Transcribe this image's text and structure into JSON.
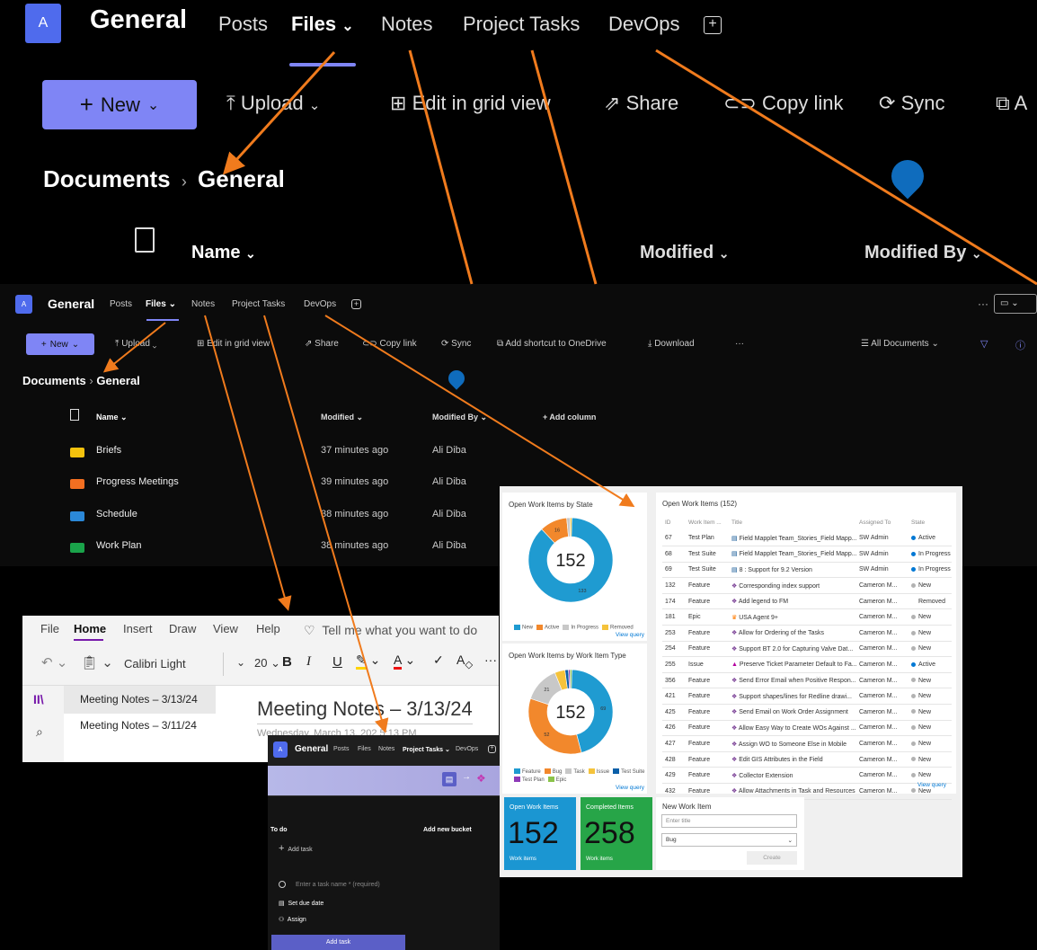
{
  "avatar_letter": "A",
  "team_name": "General",
  "tabs": [
    "Posts",
    "Files",
    "Notes",
    "Project Tasks",
    "DevOps"
  ],
  "toolbar": {
    "new": "New",
    "upload": "Upload",
    "edit_grid": "Edit in grid view",
    "share": "Share",
    "copy_link": "Copy link",
    "sync": "Sync",
    "add_shortcut": "Add shortcut to OneDrive",
    "download": "Download",
    "more": "···",
    "all_documents": "All Documents"
  },
  "breadcrumb": {
    "root": "Documents",
    "current": "General"
  },
  "columns": {
    "name": "Name",
    "modified": "Modified",
    "modified_by": "Modified By",
    "add_column": "+ Add column"
  },
  "files": [
    {
      "name": "Briefs",
      "modified": "37 minutes ago",
      "by": "Ali Diba",
      "color": "#f4c20d"
    },
    {
      "name": "Progress Meetings",
      "modified": "39 minutes ago",
      "by": "Ali Diba",
      "color": "#f36f21"
    },
    {
      "name": "Schedule",
      "modified": "38 minutes ago",
      "by": "Ali Diba",
      "color": "#2b88d8"
    },
    {
      "name": "Work Plan",
      "modified": "38 minutes ago",
      "by": "Ali Diba",
      "color": "#1aa34a"
    }
  ],
  "onenote": {
    "menu": [
      "File",
      "Home",
      "Insert",
      "Draw",
      "View",
      "Help"
    ],
    "tell_me": "Tell me what you want to do",
    "font": "Calibri Light",
    "size": "20",
    "pages": [
      "Meeting Notes – 3/13/24",
      "Meeting Notes – 3/11/24"
    ],
    "page_title": "Meeting Notes – 3/13/24",
    "date_line": "Wednesday, March 13, 202   5:13 PM"
  },
  "planner": {
    "tab_files": "Files",
    "tab_notes": "Notes",
    "todo": "To do",
    "add_bucket": "Add new bucket",
    "add_task": "Add task",
    "task_placeholder": "Enter a task name * (required)",
    "set_due": "Set due date",
    "assign": "Assign",
    "add_task_button": "Add task"
  },
  "devops": {
    "state_title": "Open Work Items by State",
    "state_legend": [
      "New",
      "Active",
      "In Progress",
      "Removed"
    ],
    "view_query": "View query",
    "type_title": "Open Work Items by Work Item Type",
    "type_legend": [
      "Feature",
      "Bug",
      "Task",
      "Issue",
      "Test Suite",
      "Test Plan",
      "Epic"
    ],
    "center_value": "152",
    "table_title": "Open Work Items (152)",
    "table_headers": [
      "ID",
      "Work Item ...",
      "Title",
      "Assigned To",
      "State"
    ],
    "rows": [
      [
        "67",
        "Test Plan",
        "Field Mapplet Team_Stories_Field Mapp...",
        "SW Admin",
        "Active"
      ],
      [
        "68",
        "Test Suite",
        "Field Mapplet Team_Stories_Field Mapp...",
        "SW Admin",
        "In Progress"
      ],
      [
        "69",
        "Test Suite",
        "8 : Support for 9.2 Version",
        "SW Admin",
        "In Progress"
      ],
      [
        "132",
        "Feature",
        "Corresponding index support",
        "Cameron M...",
        "New"
      ],
      [
        "174",
        "Feature",
        "Add legend to FM",
        "Cameron M...",
        "Removed"
      ],
      [
        "181",
        "Epic",
        "USA Agent 9+",
        "Cameron M...",
        "New"
      ],
      [
        "253",
        "Feature",
        "Allow for Ordering of the Tasks",
        "Cameron M...",
        "New"
      ],
      [
        "254",
        "Feature",
        "Support BT 2.0 for Capturing Valve Dat...",
        "Cameron M...",
        "New"
      ],
      [
        "255",
        "Issue",
        "Preserve Ticket Parameter Default to Fa...",
        "Cameron M...",
        "Active"
      ],
      [
        "356",
        "Feature",
        "Send Error Email when Positive Respon...",
        "Cameron M...",
        "New"
      ],
      [
        "421",
        "Feature",
        "Support shapes/lines for Redline drawi...",
        "Cameron M...",
        "New"
      ],
      [
        "425",
        "Feature",
        "Send Email on Work Order Assignment",
        "Cameron M...",
        "New"
      ],
      [
        "426",
        "Feature",
        "Allow Easy Way to Create WOs Against ...",
        "Cameron M...",
        "New"
      ],
      [
        "427",
        "Feature",
        "Assign WO to Someone Else in Mobile",
        "Cameron M...",
        "New"
      ],
      [
        "428",
        "Feature",
        "Edit GIS Attributes in the Field",
        "Cameron M...",
        "New"
      ],
      [
        "429",
        "Feature",
        "Collector Extension",
        "Cameron M...",
        "New"
      ],
      [
        "432",
        "Feature",
        "Allow Attachments in Task and Resources",
        "Cameron M...",
        "New"
      ]
    ],
    "tile_open_title": "Open Work Items",
    "tile_open_value": "152",
    "tile_open_sub": "Work items",
    "tile_done_title": "Completed Items",
    "tile_done_value": "258",
    "tile_done_sub": "Work items",
    "new_item_title": "New Work Item",
    "enter_title": "Enter title",
    "type_value": "Bug",
    "create": "Create"
  },
  "chart_data": [
    {
      "type": "pie",
      "title": "Open Work Items by State",
      "categories": [
        "New",
        "Active",
        "In Progress",
        "Removed"
      ],
      "values": [
        133,
        16,
        2,
        1
      ],
      "colors": [
        "#1f9bd1",
        "#f2882c",
        "#c8c8c8",
        "#f5c33b"
      ]
    },
    {
      "type": "pie",
      "title": "Open Work Items by Work Item Type",
      "categories": [
        "Feature",
        "Bug",
        "Task",
        "Issue",
        "Test Suite",
        "Test Plan",
        "Epic"
      ],
      "values": [
        69,
        52,
        21,
        6,
        2,
        1,
        1
      ],
      "colors": [
        "#1f9bd1",
        "#f2882c",
        "#c8c8c8",
        "#f5c33b",
        "#0a5fa8",
        "#8e3ab8",
        "#8bc34a"
      ]
    }
  ]
}
